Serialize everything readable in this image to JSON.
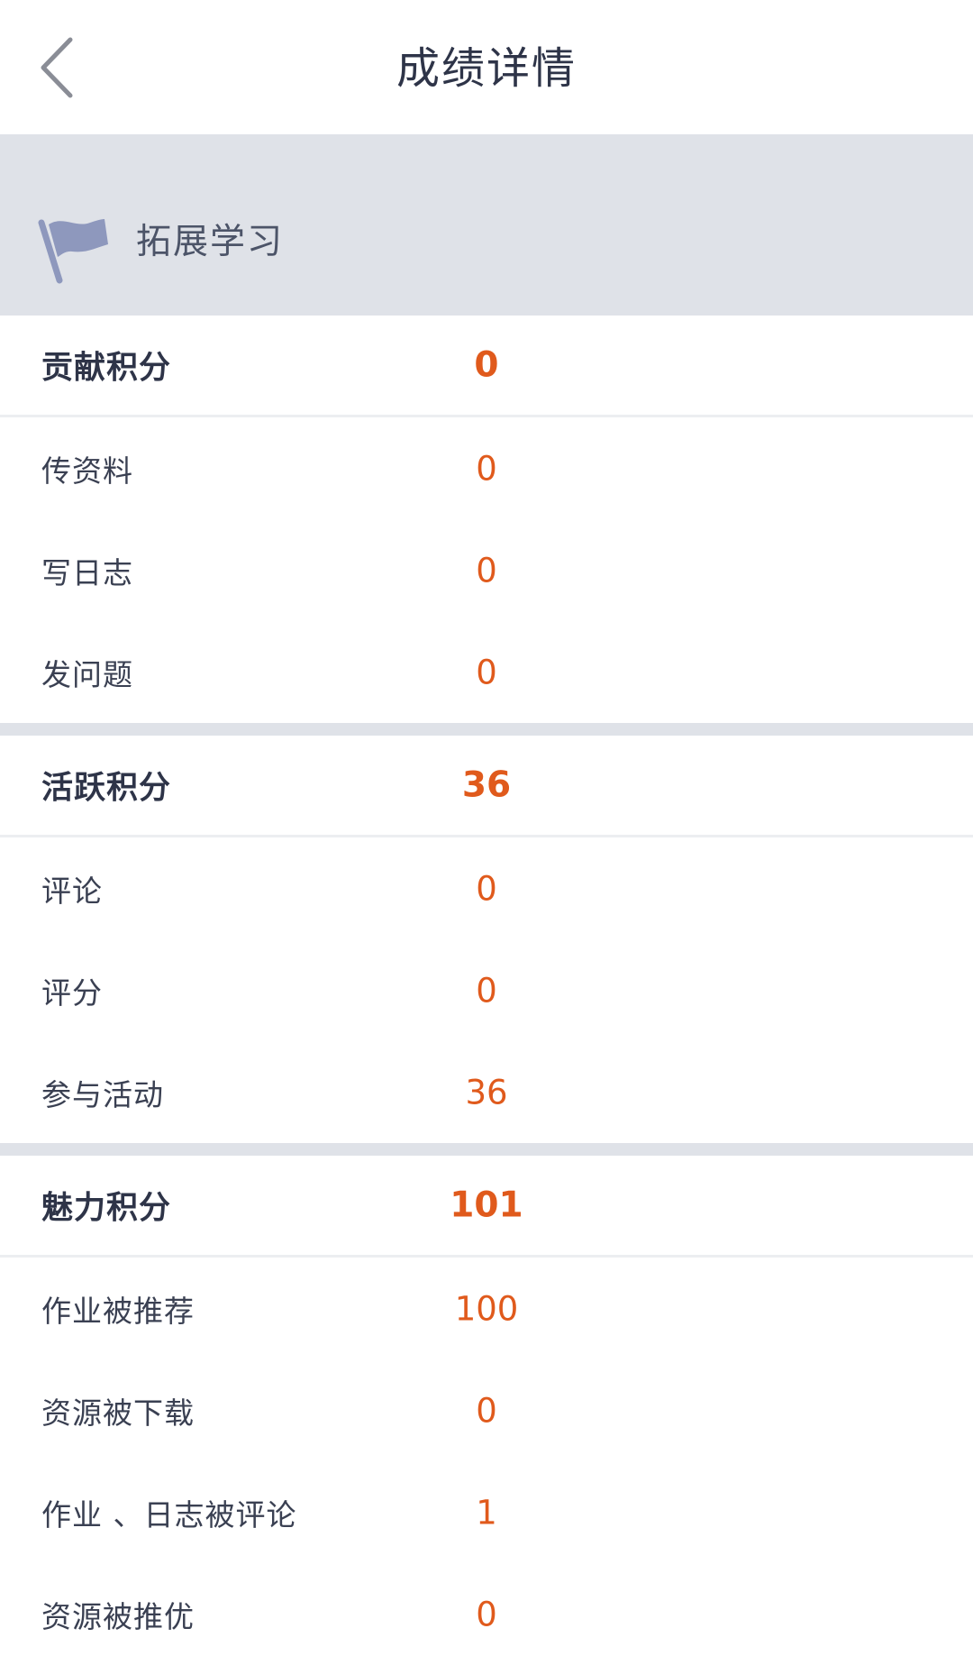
{
  "header": {
    "title": "成绩详情",
    "back_icon": "chevron-left-icon"
  },
  "banner": {
    "icon": "flag-icon",
    "label": "拓展学习"
  },
  "colors": {
    "accent": "#e05a1c",
    "banner_bg": "#dfe2e8",
    "flag": "#8e98bd"
  },
  "groups": [
    {
      "title": "贡献积分",
      "total": "0",
      "items": [
        {
          "label": "传资料",
          "value": "0"
        },
        {
          "label": "写日志",
          "value": "0"
        },
        {
          "label": "发问题",
          "value": "0"
        }
      ]
    },
    {
      "title": "活跃积分",
      "total": "36",
      "items": [
        {
          "label": "评论",
          "value": "0"
        },
        {
          "label": "评分",
          "value": "0"
        },
        {
          "label": "参与活动",
          "value": "36"
        }
      ]
    },
    {
      "title": "魅力积分",
      "total": "101",
      "items": [
        {
          "label": "作业被推荐",
          "value": "100"
        },
        {
          "label": "资源被下载",
          "value": "0"
        },
        {
          "label": "作业 、日志被评论",
          "value": "1"
        },
        {
          "label": "资源被推优",
          "value": "0"
        }
      ]
    }
  ]
}
